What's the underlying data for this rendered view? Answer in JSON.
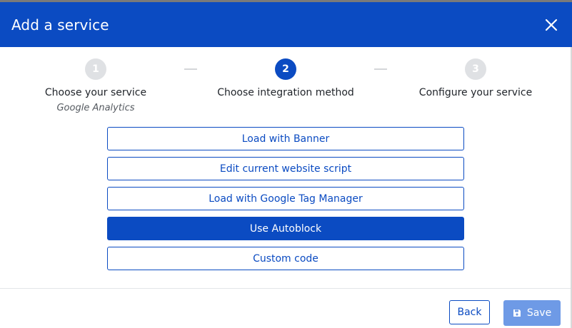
{
  "dialog": {
    "title": "Add a service",
    "close_icon": "close-icon"
  },
  "stepper": {
    "steps": [
      {
        "number": "1",
        "label": "Choose your service",
        "sublabel": "Google Analytics",
        "state": "completed"
      },
      {
        "number": "2",
        "label": "Choose integration method",
        "state": "active"
      },
      {
        "number": "3",
        "label": "Configure your service",
        "state": "upcoming"
      }
    ]
  },
  "options": [
    {
      "label": "Load with Banner",
      "selected": false
    },
    {
      "label": "Edit current website script",
      "selected": false
    },
    {
      "label": "Load with Google Tag Manager",
      "selected": false
    },
    {
      "label": "Use Autoblock",
      "selected": true
    },
    {
      "label": "Custom code",
      "selected": false
    }
  ],
  "footer": {
    "back_label": "Back",
    "save_label": "Save",
    "save_icon": "floppy-disk-icon"
  },
  "colors": {
    "primary": "#0b4bc2",
    "save_disabled": "#6e9ae6",
    "step_inactive": "#dfe1e4"
  }
}
